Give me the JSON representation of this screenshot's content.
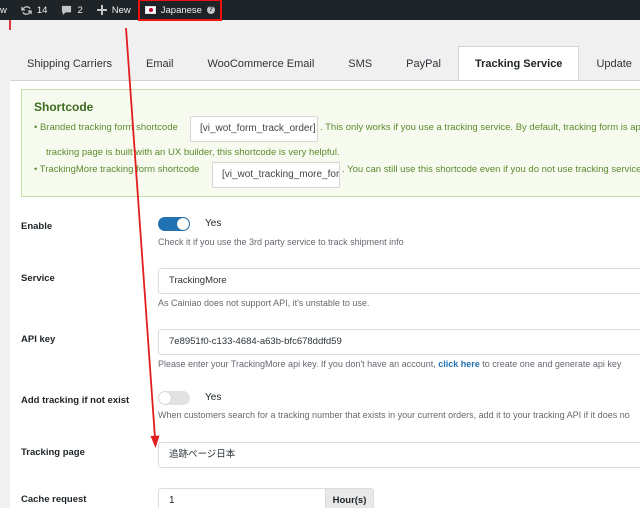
{
  "admin_bar": {
    "site_label": "w",
    "updates_count": "14",
    "comments_count": "2",
    "new_label": "New",
    "language_label": "Japanese",
    "language_help": "?"
  },
  "tabs": [
    {
      "label": "Shipping Carriers"
    },
    {
      "label": "Email"
    },
    {
      "label": "WooCommerce Email"
    },
    {
      "label": "SMS"
    },
    {
      "label": "PayPal"
    },
    {
      "label": "Tracking Service"
    },
    {
      "label": "Update"
    }
  ],
  "active_tab": "Tracking Service",
  "shortcode": {
    "title": "Shortcode",
    "line1_prefix": "• Branded tracking form shortcode",
    "line1_code": "[vi_wot_form_track_order]",
    "line1_suffix": ". This only works if you use a tracking service. By default, tracking form is ap",
    "line1_cont": "tracking page is built with an UX builder, this shortcode is very helpful.",
    "line2_prefix": "• TrackingMore tracking form shortcode",
    "line2_code": "[vi_wot_tracking_more_form]",
    "line2_suffix": ". You can still use this shortcode even if you do not use tracking service"
  },
  "form": {
    "enable": {
      "label": "Enable",
      "value": "Yes",
      "on": true,
      "description": "Check it if you use the 3rd party service to track shipment info"
    },
    "service": {
      "label": "Service",
      "value": "TrackingMore",
      "description": "As Cainiao does not support API, it's unstable to use."
    },
    "api_key": {
      "label": "API key",
      "value": "7e8951f0-c133-4684-a63b-bfc678ddfd59",
      "description_prefix": "Please enter your TrackingMore api key. If you don't have an account,",
      "link": "click here",
      "description_suffix": "to create one and generate api key"
    },
    "add_tracking": {
      "label": "Add tracking if not exist",
      "value": "Yes",
      "on": false,
      "description": "When customers search for a tracking number that exists in your current orders, add it to your tracking API if it does no"
    },
    "tracking_page": {
      "label": "Tracking page",
      "value": "追跡ページ日本"
    },
    "cache_request": {
      "label": "Cache request",
      "value": "1",
      "unit": "Hour(s)"
    }
  },
  "colors": {
    "accent": "#2271b1",
    "annotation": "#e11d1d",
    "notice_text": "#5c8a2e"
  }
}
